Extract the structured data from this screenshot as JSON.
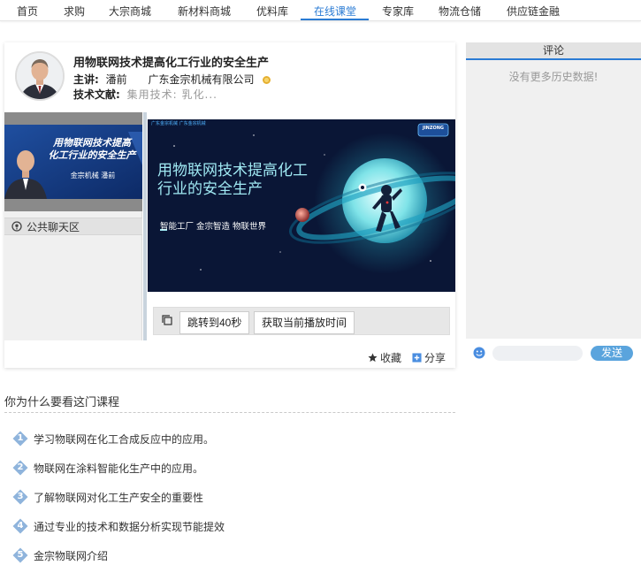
{
  "nav": {
    "items": [
      "首页",
      "求购",
      "大宗商城",
      "新材料商城",
      "优料库",
      "在线课堂",
      "专家库",
      "物流仓储",
      "供应链金融"
    ],
    "active_index": 5
  },
  "course": {
    "title": "用物联网技术提高化工行业的安全生产",
    "speaker_label": "主讲:",
    "speaker_name": "潘前",
    "company": "广东金宗机械有限公司",
    "docs_label": "技术文献:",
    "docs_value": "集用技术: 乳化..."
  },
  "speaker_cam": {
    "title_line1": "用物联网技术提高",
    "title_line2": "化工行业的安全生产",
    "caption": "金宗机械  潘前"
  },
  "chat": {
    "tab_label": "公共聊天区"
  },
  "slide": {
    "corner_text": "广东金宗机械  广东金宗机械",
    "logo_text": "JINZONG",
    "title_line1": "用物联网技术提高化工",
    "title_line2": "行业的安全生产",
    "subtitle": "智能工厂  金宗智造  物联世界"
  },
  "controls": {
    "jump_label": "跳转到40秒",
    "get_time_label": "获取当前播放时间"
  },
  "footer": {
    "favorite_label": "收藏",
    "share_label": "分享"
  },
  "comments": {
    "header": "评论",
    "empty_text": "没有更多历史数据!",
    "input_placeholder": "",
    "send_label": "发送"
  },
  "why": {
    "title": "你为什么要看这门课程",
    "reasons": [
      {
        "num": "1",
        "text": "学习物联网在化工合成反应中的应用。"
      },
      {
        "num": "2",
        "text": "物联网在涂料智能化生产中的应用。"
      },
      {
        "num": "3",
        "text": "了解物联网对化工生产安全的重要性"
      },
      {
        "num": "4",
        "text": "通过专业的技术和数据分析实现节能提效"
      },
      {
        "num": "5",
        "text": "金宗物联网介绍"
      }
    ]
  },
  "colors": {
    "accent": "#2a7bd4",
    "send_button": "#5aa4dd",
    "reason_badge": "#8fb4dc",
    "slide_bg": "#0a1636",
    "slide_title": "#9fe8f2"
  }
}
